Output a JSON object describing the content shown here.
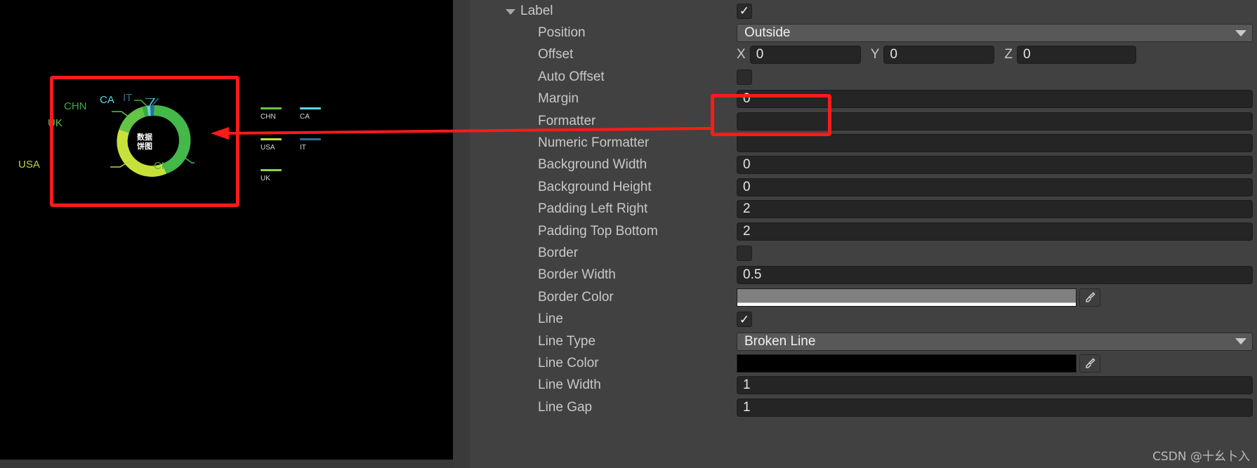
{
  "scene": {
    "chart": {
      "center_lines": [
        "数据",
        "饼图"
      ],
      "slice_labels": [
        {
          "text": "CHN",
          "color": "#3fa93f"
        },
        {
          "text": "CA",
          "color": "#5ad8e8"
        },
        {
          "text": "IT",
          "color": "#2f6f96"
        },
        {
          "text": "UK",
          "color": "#63c446"
        },
        {
          "text": "USA",
          "color": "#bcd63a"
        },
        {
          "text": "CHN",
          "color": "#45b84a"
        }
      ],
      "legend": [
        {
          "label": "CHN",
          "color": "#68c645"
        },
        {
          "label": "CA",
          "color": "#5ad8e8"
        },
        {
          "label": "USA",
          "color": "#c7e13b"
        },
        {
          "label": "IT",
          "color": "#2f6f96"
        },
        {
          "label": "UK",
          "color": "#8ed53f"
        }
      ]
    }
  },
  "chart_data": {
    "type": "pie",
    "title": "数据饼图",
    "categories": [
      "CHN",
      "CA",
      "IT",
      "UK",
      "USA",
      "CHN"
    ],
    "values": [
      38,
      3,
      4,
      14,
      17,
      24
    ],
    "colors": [
      "#45b84a",
      "#5ad8e8",
      "#2f6f96",
      "#63c446",
      "#c7e13b",
      "#68c645"
    ],
    "legend_position": "right",
    "donut": true,
    "xlabel": "",
    "ylabel": ""
  },
  "inspector": {
    "section": {
      "title": "Label",
      "enabled": true
    },
    "rows": [
      {
        "label": "Position",
        "type": "dropdown",
        "value": "Outside"
      },
      {
        "label": "Offset",
        "type": "vector3",
        "x": "0",
        "y": "0",
        "z": "0",
        "axis": [
          "X",
          "Y",
          "Z"
        ]
      },
      {
        "label": "Auto Offset",
        "type": "checkbox",
        "checked": false
      },
      {
        "label": "Margin",
        "type": "text",
        "value": "0"
      },
      {
        "label": "Formatter",
        "type": "text",
        "value": ""
      },
      {
        "label": "Numeric Formatter",
        "type": "text",
        "value": ""
      },
      {
        "label": "Background Width",
        "type": "text",
        "value": "0"
      },
      {
        "label": "Background Height",
        "type": "text",
        "value": "0"
      },
      {
        "label": "Padding Left Right",
        "type": "text",
        "value": "2"
      },
      {
        "label": "Padding Top Bottom",
        "type": "text",
        "value": "2"
      },
      {
        "label": "Border",
        "type": "checkbox",
        "checked": false
      },
      {
        "label": "Border Width",
        "type": "text",
        "value": "0.5"
      },
      {
        "label": "Border Color",
        "type": "color",
        "color": "#808080",
        "underline": "#ffffff"
      },
      {
        "label": "Line",
        "type": "checkbox",
        "checked": true
      },
      {
        "label": "Line Type",
        "type": "dropdown",
        "value": "Broken Line"
      },
      {
        "label": "Line Color",
        "type": "color",
        "color": "#000000",
        "underline": "#000000"
      },
      {
        "label": "Line Width",
        "type": "text",
        "value": "1"
      },
      {
        "label": "Line Gap",
        "type": "text",
        "value": "1"
      }
    ],
    "icons": {
      "foldout": "triangle-down-icon",
      "caret": "chevron-down-icon",
      "eyedropper": "eyedropper-icon",
      "check": "check-icon"
    }
  },
  "watermark": "CSDN @十幺卜入"
}
